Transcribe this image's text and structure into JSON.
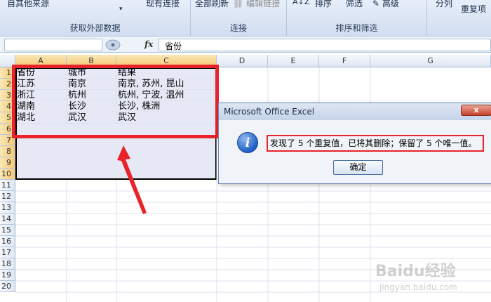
{
  "ribbon": {
    "groups": [
      {
        "label": "获取外部数据",
        "buttons": [
          "自其他来源",
          "现有连接"
        ]
      },
      {
        "label": "连接",
        "buttons": [
          "全部刷新",
          "编辑链接"
        ]
      },
      {
        "label": "排序和筛选",
        "buttons": [
          "排序",
          "筛选",
          "高级"
        ]
      },
      {
        "label": "",
        "buttons": [
          "重复项"
        ]
      }
    ]
  },
  "formula_bar": {
    "fx": "fx",
    "content": "省份"
  },
  "sheet": {
    "columns": [
      "A",
      "B",
      "C",
      "D",
      "E",
      "F",
      "G"
    ],
    "rows": [
      "1",
      "2",
      "3",
      "4",
      "5",
      "6",
      "7",
      "8",
      "9",
      "10",
      "11",
      "12",
      "13",
      "14",
      "15",
      "16",
      "17",
      "18",
      "19",
      "20"
    ],
    "cells": [
      [
        "省份",
        "城市",
        "结果"
      ],
      [
        "江苏",
        "南京",
        "南京, 苏州, 昆山"
      ],
      [
        "浙江",
        "杭州",
        "杭州, 宁波, 温州"
      ],
      [
        "湖南",
        "长沙",
        "长沙, 株洲"
      ],
      [
        "湖北",
        "武汉",
        "武汉"
      ]
    ]
  },
  "dialog": {
    "title": "Microsoft Office Excel",
    "close": "x",
    "message": "发现了 5 个重复值，已将其删除；保留了 5 个唯一值。",
    "ok": "确定"
  },
  "watermark": {
    "brand": "Baidu经验",
    "url": "jingyan.baidu.com"
  },
  "colors": {
    "highlight": "#e8232a",
    "selection": "#e6e9f5"
  }
}
